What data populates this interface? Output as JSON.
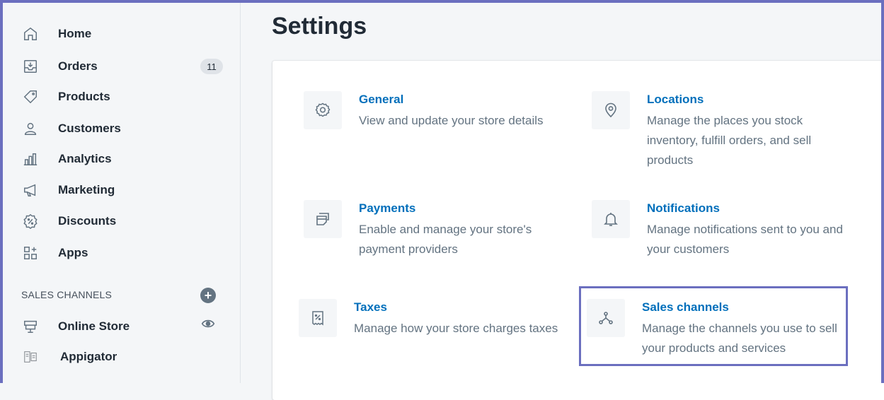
{
  "sidebar": {
    "items": [
      {
        "label": "Home",
        "icon": "home-icon"
      },
      {
        "label": "Orders",
        "icon": "orders-icon",
        "badge": "11"
      },
      {
        "label": "Products",
        "icon": "tag-icon"
      },
      {
        "label": "Customers",
        "icon": "person-icon"
      },
      {
        "label": "Analytics",
        "icon": "bar-chart-icon"
      },
      {
        "label": "Marketing",
        "icon": "megaphone-icon"
      },
      {
        "label": "Discounts",
        "icon": "discount-icon"
      },
      {
        "label": "Apps",
        "icon": "apps-icon"
      }
    ],
    "sales_channels": {
      "header": "SALES CHANNELS",
      "items": [
        {
          "label": "Online Store",
          "icon": "store-icon"
        },
        {
          "label": "Appigator",
          "icon": "appigator-icon"
        }
      ]
    }
  },
  "main": {
    "title": "Settings",
    "settings": [
      {
        "title": "General",
        "description": "View and update your store details",
        "icon": "gear-icon"
      },
      {
        "title": "Locations",
        "description": "Manage the places you stock inventory, fulfill orders, and sell products",
        "icon": "location-pin-icon"
      },
      {
        "title": "Payments",
        "description": "Enable and manage your store's payment providers",
        "icon": "payments-icon"
      },
      {
        "title": "Notifications",
        "description": "Manage notifications sent to you and your customers",
        "icon": "bell-icon"
      },
      {
        "title": "Taxes",
        "description": "Manage how your store charges taxes",
        "icon": "tax-receipt-icon"
      },
      {
        "title": "Sales channels",
        "description": "Manage the channels you use to sell your products and services",
        "icon": "sales-channels-icon"
      }
    ]
  },
  "colors": {
    "accent": "#006fbb",
    "highlight": "#6b6fbf",
    "text": "#212b36",
    "subdued": "#637381"
  }
}
